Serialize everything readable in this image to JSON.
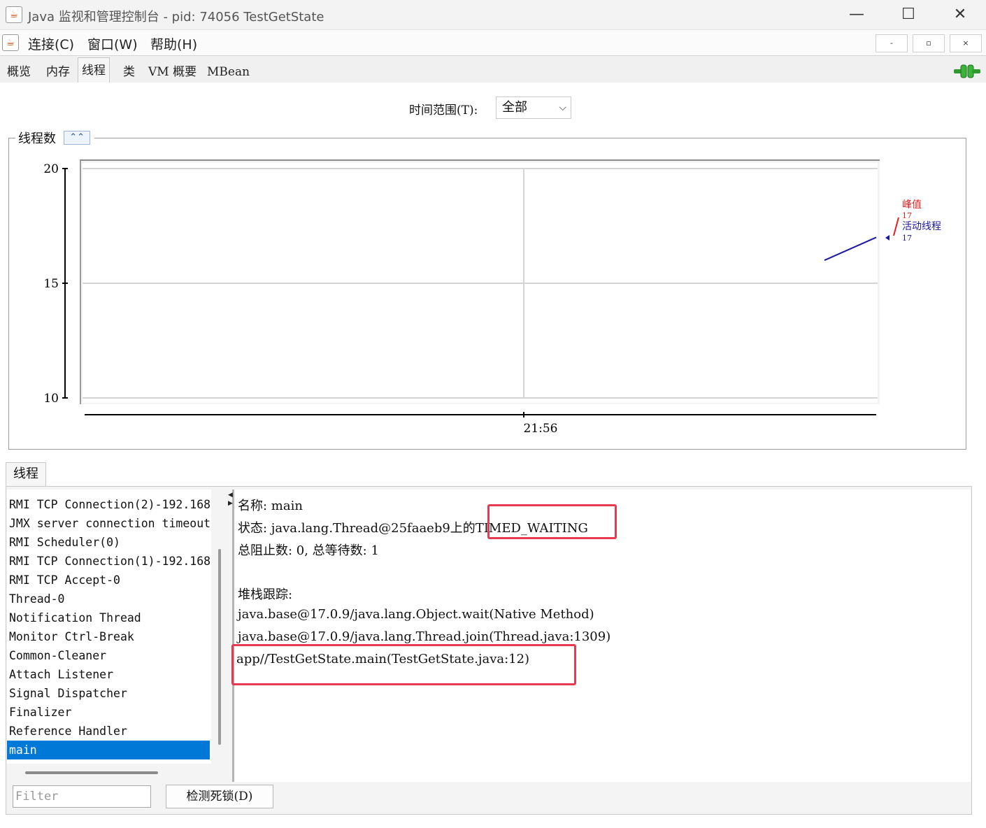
{
  "window": {
    "title": "Java 监视和管理控制台 - pid: 74056 TestGetState",
    "app_icon": "java-coffee-icon",
    "controls": [
      "minimize-icon",
      "maximize-icon",
      "close-icon"
    ]
  },
  "menubar": {
    "items": [
      "连接(C)",
      "窗口(W)",
      "帮助(H)"
    ],
    "mdi_buttons": [
      "-",
      "▫",
      "×"
    ]
  },
  "tabs": {
    "items": [
      "概览",
      "内存",
      "线程",
      "类",
      "VM 概要",
      "MBean"
    ],
    "selected": "线程",
    "connection_icon": "plug-connected-icon"
  },
  "time_range": {
    "label": "时间范围(T):",
    "value": "全部"
  },
  "chart_panel": {
    "title": "线程数",
    "collapse_icon": "double-chevron-up-icon"
  },
  "chart_data": {
    "type": "line",
    "ylim": [
      10,
      20
    ],
    "yticks": [
      "20",
      "15",
      "10"
    ],
    "xticks": [
      "21:56"
    ],
    "grid": true,
    "series": [
      {
        "name": "峰值",
        "current": "17",
        "color": "#e02020"
      },
      {
        "name": "活动线程",
        "current": "17",
        "color": "#1a1aa0",
        "values": [
          16,
          17
        ]
      }
    ],
    "legend_position": "right"
  },
  "threads": {
    "tab_label": "线程",
    "list": [
      "RMI TCP Connection(2)-192.168.",
      "JMX server connection timeout",
      "RMI Scheduler(0)",
      "RMI TCP Connection(1)-192.168.",
      "RMI TCP Accept-0",
      "Thread-0",
      "Notification Thread",
      "Monitor Ctrl-Break",
      "Common-Cleaner",
      "Attach Listener",
      "Signal Dispatcher",
      "Finalizer",
      "Reference Handler",
      "main"
    ],
    "selected": "main",
    "filter_placeholder": "Filter",
    "deadlock_button": "检测死锁(D)"
  },
  "details": {
    "name_line": "名称: main",
    "state_prefix": "状态: java.lang.Thread@25faaeb9上的",
    "state_value": "TIMED_WAITING",
    "counts_line": "总阻止数: 0, 总等待数: 1",
    "stack_header": "堆栈跟踪:",
    "stack": [
      "java.base@17.0.9/java.lang.Object.wait(Native Method)",
      "java.base@17.0.9/java.lang.Thread.join(Thread.java:1309)",
      "app//TestGetState.main(TestGetState.java:12)"
    ]
  }
}
